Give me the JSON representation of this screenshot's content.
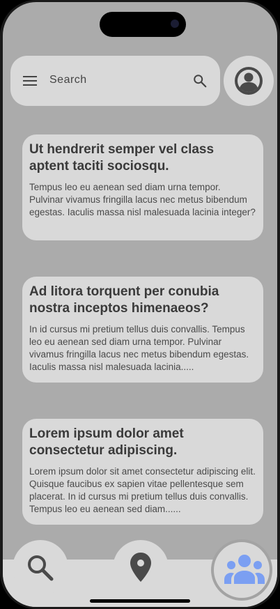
{
  "search": {
    "placeholder": "Search",
    "menu_icon": "hamburger-menu-icon",
    "search_icon": "magnifier-icon"
  },
  "profile": {
    "icon": "account-circle-icon"
  },
  "cards": [
    {
      "title": "Ut hendrerit semper vel class aptent taciti sociosqu.",
      "body": "Tempus leo eu aenean sed diam urna tempor. Pulvinar vivamus fringilla lacus nec metus bibendum egestas. Iaculis massa nisl malesuada lacinia integer?"
    },
    {
      "title": "Ad litora torquent per conubia nostra inceptos himenaeos?",
      "body": " In id cursus mi pretium tellus duis convallis. Tempus leo eu aenean sed diam urna tempor. Pulvinar vivamus fringilla lacus nec metus bibendum egestas. Iaculis massa nisl malesuada lacinia....."
    },
    {
      "title": "Lorem ipsum dolor amet consectetur adipiscing.",
      "body": "Lorem ipsum dolor sit amet consectetur adipiscing elit. Quisque faucibus ex sapien vitae pellentesque sem placerat. In id cursus mi pretium tellus duis convallis. Tempus leo eu aenean sed diam......"
    }
  ],
  "nav": {
    "items": [
      {
        "icon": "search-icon",
        "active": false
      },
      {
        "icon": "location-pin-icon",
        "active": false
      },
      {
        "icon": "groups-icon",
        "active": true
      }
    ],
    "active_color": "#7b9ff2",
    "icon_color": "#4a4a4a"
  }
}
